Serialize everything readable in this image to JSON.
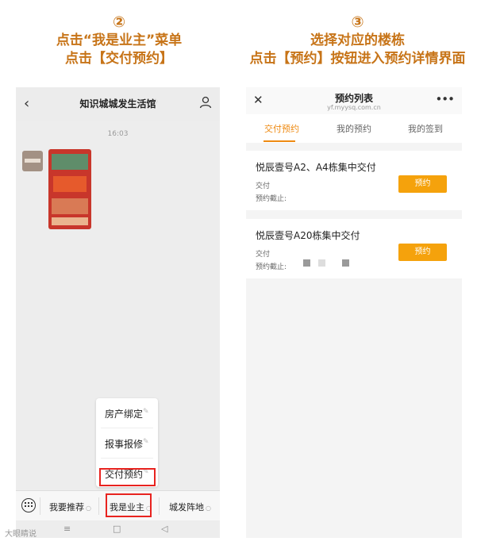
{
  "captions": {
    "left": {
      "num": "②",
      "line1": "点击“我是业主”菜单",
      "line2": "点击【交付预约】"
    },
    "right": {
      "num": "③",
      "line1": "选择对应的楼栋",
      "line2": "点击【预约】按钮进入预约详情界面"
    }
  },
  "left_phone": {
    "header": {
      "title": "知识城城发生活馆"
    },
    "timestamp": "16:03",
    "popup_menu": [
      {
        "label": "房产绑定"
      },
      {
        "label": "报事报修"
      },
      {
        "label": "交付预约"
      }
    ],
    "bottom_menu": [
      {
        "label": "我要推荐"
      },
      {
        "label": "我是业主"
      },
      {
        "label": "城发阵地"
      }
    ],
    "navbar": {
      "menu_icon": "≡",
      "home_icon": "□",
      "back_icon": "◁"
    },
    "watermark": "大眼睛说"
  },
  "right_phone": {
    "header": {
      "title": "预约列表",
      "url": "yf.myysq.com.cn",
      "more": "•••"
    },
    "tabs": [
      {
        "label": "交付预约",
        "active": true
      },
      {
        "label": "我的预约",
        "active": false
      },
      {
        "label": "我的签到",
        "active": false
      }
    ],
    "cards": [
      {
        "title": "悦辰壹号A2、A4栋集中交付",
        "line1": "交付",
        "line2": "预约截止:",
        "button": "预约"
      },
      {
        "title": "悦辰壹号A20栋集中交付",
        "line1": "交付",
        "line2": "预约截止:",
        "button": "预约"
      }
    ]
  },
  "colors": {
    "accent": "#ee8a12",
    "button": "#f5a20c",
    "highlight": "#e8231f",
    "caption": "#c77418"
  }
}
